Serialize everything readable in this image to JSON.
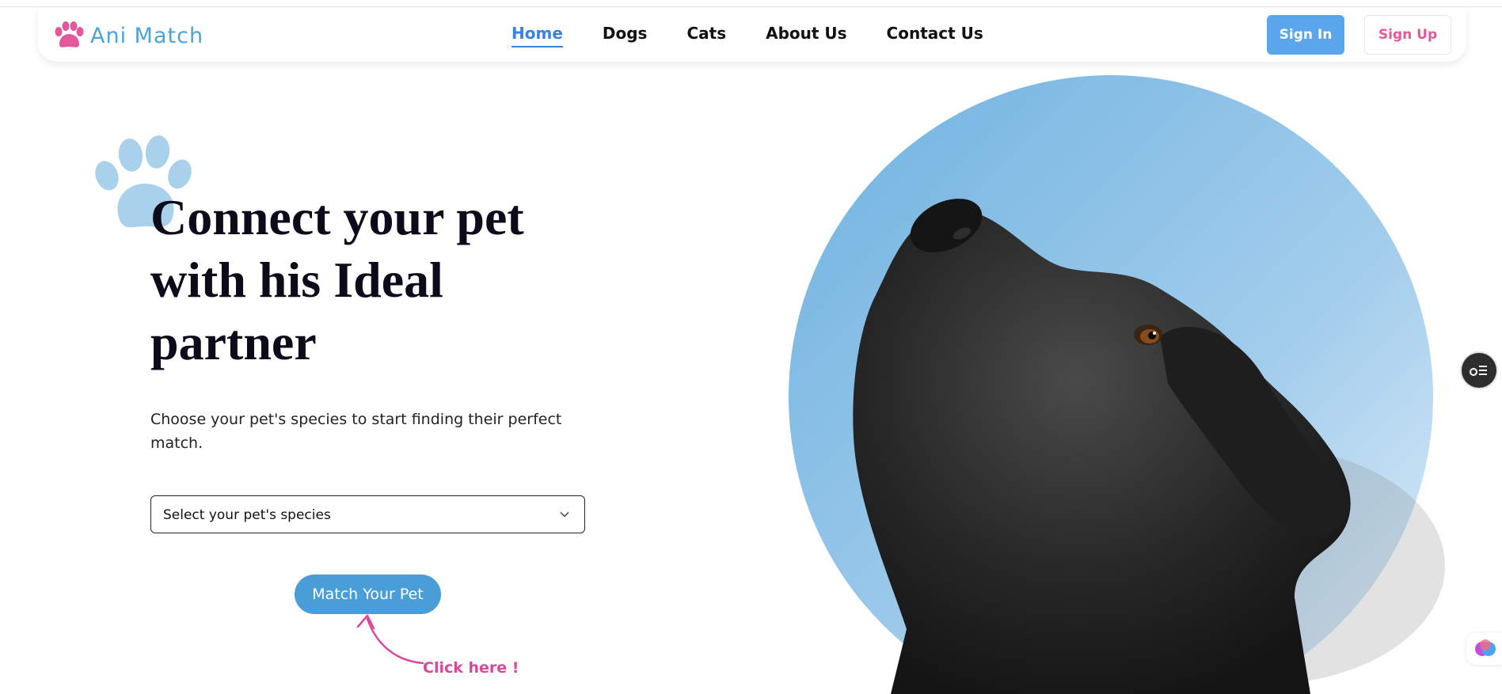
{
  "brand": {
    "name": "Ani Match",
    "logo_icon": "paw-icon",
    "accent": "#e2589b",
    "blue": "#4da3d8"
  },
  "nav": {
    "items": [
      {
        "label": "Home",
        "active": true
      },
      {
        "label": "Dogs",
        "active": false
      },
      {
        "label": "Cats",
        "active": false
      },
      {
        "label": "About Us",
        "active": false
      },
      {
        "label": "Contact Us",
        "active": false
      }
    ],
    "sign_in": "Sign In",
    "sign_up": "Sign Up"
  },
  "hero": {
    "headline": "Connect your pet with his Ideal partner",
    "subtext": "Choose your pet's species to start finding their perfect match.",
    "select": {
      "selected": "Select your pet's species",
      "icon": "chevron-down-icon"
    },
    "cta": "Match Your Pet",
    "hint": "Click here !",
    "image": "black-labrador-dog-photo"
  },
  "floating": {
    "tool_icon": "settings-list-icon",
    "assistant_icon": "brain-icon"
  }
}
